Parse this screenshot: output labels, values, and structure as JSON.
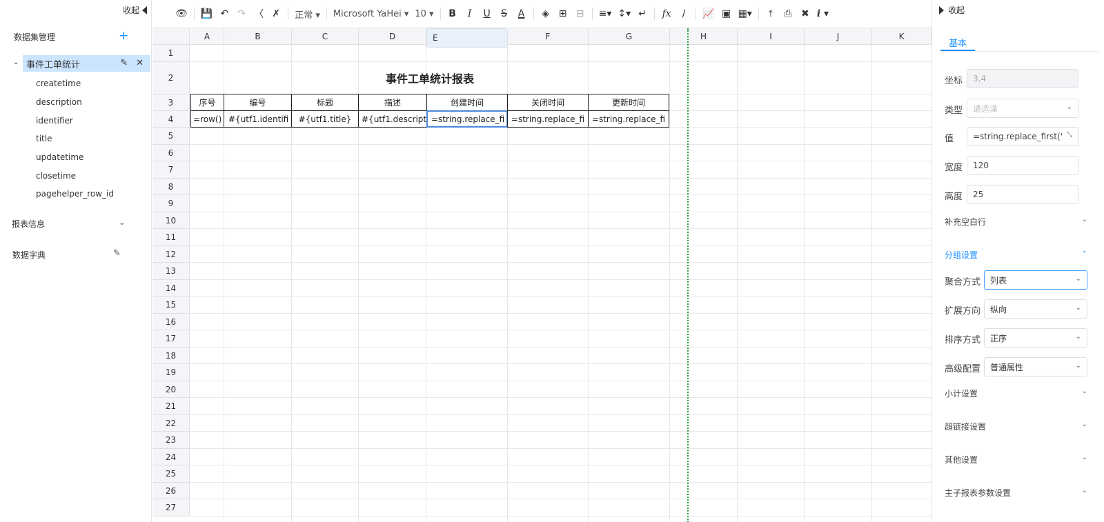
{
  "left": {
    "collapse_label": "收起",
    "dataset_title": "数据集管理",
    "dataset_add": "+",
    "dataset_name": "事件工单统计",
    "fields": [
      "createtime",
      "description",
      "identifier",
      "title",
      "updatetime",
      "closetime",
      "pagehelper_row_id"
    ],
    "report_info": "报表信息",
    "dictionary": "数据字典"
  },
  "toolbar": {
    "style_select": "正常",
    "font_select": "Microsoft YaHei",
    "size_select": "10",
    "fx": "fx"
  },
  "grid": {
    "columns": [
      "A",
      "B",
      "C",
      "D",
      "E",
      "F",
      "G",
      "H",
      "I",
      "J",
      "K"
    ],
    "rows": [
      "1",
      "2",
      "3",
      "4",
      "5",
      "6",
      "7",
      "8",
      "9",
      "10",
      "11",
      "12",
      "13",
      "14",
      "15",
      "16",
      "17",
      "18",
      "19",
      "20",
      "21",
      "22",
      "23",
      "24",
      "25",
      "26",
      "27"
    ],
    "report_title": "事件工单统计报表",
    "headers": [
      "序号",
      "编号",
      "标题",
      "描述",
      "创建时间",
      "关闭时间",
      "更新时间"
    ],
    "values": [
      "=row()",
      "#{utf1.identifi",
      "#{utf1.title}",
      "#{utf1.descript",
      "=string.replace_fi",
      "=string.replace_fi",
      "=string.replace_fi"
    ]
  },
  "right": {
    "collapse_label": "收起",
    "tab": "基本",
    "coord_label": "坐标",
    "coord_value": "3,4",
    "type_label": "类型",
    "type_placeholder": "请选泽",
    "value_label": "值",
    "value_value": "=string.replace_first('#{t",
    "width_label": "宽度",
    "width_value": "120",
    "height_label": "高度",
    "height_value": "25",
    "fill_blank": "补充空白行",
    "group_settings": "分组设置",
    "agg_label": "聚合方式",
    "agg_value": "列表",
    "expand_label": "扩展方向",
    "expand_value": "纵向",
    "sort_label": "排序方式",
    "sort_value": "正序",
    "adv_label": "高级配置",
    "adv_value": "普通属性",
    "subtotal": "小计设置",
    "hyperlink": "超链接设置",
    "other": "其他设置",
    "master_sub": "主子报表参数设置"
  }
}
